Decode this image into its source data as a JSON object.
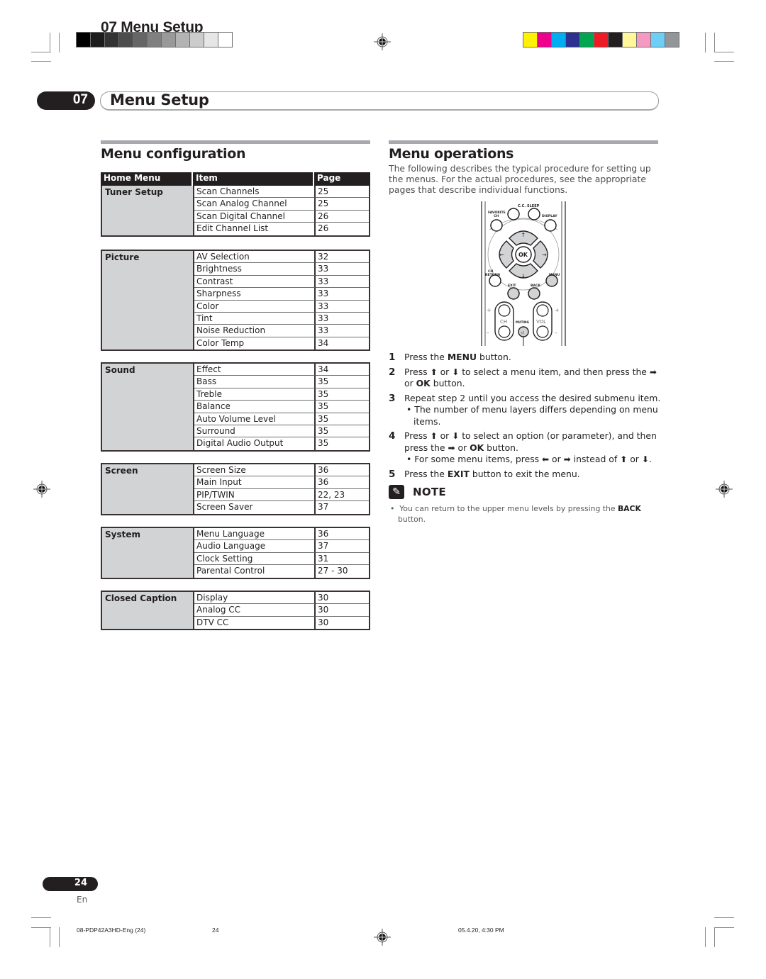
{
  "running_head": "07 Menu Setup",
  "gray_swatches": [
    "#000000",
    "#1c1c1c",
    "#333333",
    "#4d4d4d",
    "#666666",
    "#808080",
    "#999999",
    "#b3b3b3",
    "#cccccc",
    "#e6e6e6",
    "#ffffff"
  ],
  "color_swatches": [
    "#fff200",
    "#ec008c",
    "#00aeef",
    "#2e3192",
    "#00a651",
    "#ed1c24",
    "#231f20",
    "#fff799",
    "#f49ac1",
    "#6dcff6",
    "#939598"
  ],
  "chapter": {
    "number": "07",
    "title": "Menu Setup"
  },
  "menu_configuration": {
    "title": "Menu configuration",
    "headers": [
      "Home Menu",
      "Item",
      "Page"
    ],
    "groups": [
      {
        "category": "Tuner Setup",
        "rows": [
          {
            "item": "Scan Channels",
            "page": "25"
          },
          {
            "item": "Scan Analog Channel",
            "page": "25"
          },
          {
            "item": "Scan Digital Channel",
            "page": "26"
          },
          {
            "item": "Edit Channel List",
            "page": "26"
          }
        ]
      },
      {
        "category": "Picture",
        "rows": [
          {
            "item": "AV Selection",
            "page": "32"
          },
          {
            "item": "Brightness",
            "page": "33"
          },
          {
            "item": "Contrast",
            "page": "33"
          },
          {
            "item": "Sharpness",
            "page": "33"
          },
          {
            "item": "Color",
            "page": "33"
          },
          {
            "item": "Tint",
            "page": "33"
          },
          {
            "item": "Noise Reduction",
            "page": "33"
          },
          {
            "item": "Color Temp",
            "page": "34"
          }
        ]
      },
      {
        "category": "Sound",
        "rows": [
          {
            "item": "Effect",
            "page": "34"
          },
          {
            "item": "Bass",
            "page": "35"
          },
          {
            "item": "Treble",
            "page": "35"
          },
          {
            "item": "Balance",
            "page": "35"
          },
          {
            "item": "Auto Volume Level",
            "page": "35"
          },
          {
            "item": "Surround",
            "page": "35"
          },
          {
            "item": "Digital Audio Output",
            "page": "35"
          }
        ]
      },
      {
        "category": "Screen",
        "rows": [
          {
            "item": "Screen Size",
            "page": "36"
          },
          {
            "item": "Main Input",
            "page": "36"
          },
          {
            "item": "PIP/TWIN",
            "page": "22, 23"
          },
          {
            "item": "Screen Saver",
            "page": "37"
          }
        ]
      },
      {
        "category": "System",
        "rows": [
          {
            "item": "Menu Language",
            "page": "36"
          },
          {
            "item": "Audio Language",
            "page": "37"
          },
          {
            "item": "Clock Setting",
            "page": "31"
          },
          {
            "item": "Parental Control",
            "page": "27 - 30"
          }
        ]
      },
      {
        "category": "Closed Caption",
        "rows": [
          {
            "item": "Display",
            "page": "30"
          },
          {
            "item": "Analog CC",
            "page": "30"
          },
          {
            "item": "DTV CC",
            "page": "30"
          }
        ]
      }
    ]
  },
  "menu_operations": {
    "title": "Menu operations",
    "intro": "The following describes the typical procedure for setting up the menus. For the actual procedures, see the appropriate pages that describe individual functions.",
    "remote_labels": {
      "cc": "C.C.",
      "sleep": "SLEEP",
      "favorite": "FAVORITE",
      "favorite2": "CH",
      "display": "DISPLAY",
      "ok": "OK",
      "ch_return": "CH",
      "ch_return2": "RETURN",
      "menu": "MENU",
      "exit": "EXIT",
      "back": "BACK",
      "ch": "CH",
      "vol": "VOL",
      "muting": "MUTING",
      "plus": "+",
      "minus": "–"
    },
    "steps": [
      {
        "num": "1",
        "parts": [
          "Press the ",
          "MENU",
          " button."
        ]
      },
      {
        "num": "2",
        "parts": [
          "Press ",
          "⬆",
          " or ",
          "⬇",
          " to select a menu item, and then press the ",
          "➡",
          " or ",
          "OK",
          " button."
        ]
      },
      {
        "num": "3",
        "text": "Repeat step 2 until you access the desired submenu item.",
        "sub": "The number of menu layers differs depending on menu items."
      },
      {
        "num": "4",
        "parts": [
          "Press ",
          "⬆",
          " or ",
          "⬇",
          " to select an option (or parameter), and then press the ",
          "➡",
          " or ",
          "OK",
          " button."
        ],
        "sub_parts": [
          "For some menu items, press ",
          "⬅",
          " or ",
          "➡",
          " instead of ",
          "⬆",
          " or ",
          "⬇",
          "."
        ]
      },
      {
        "num": "5",
        "parts": [
          "Press the ",
          "EXIT",
          " button to exit the menu."
        ]
      }
    ],
    "note": {
      "title": "NOTE",
      "text_before": "You can return to the upper menu levels by pressing the ",
      "text_bold": "BACK",
      "text_after": " button."
    }
  },
  "footer": {
    "page_number": "24",
    "language": "En",
    "file_name": "08-PDP42A3HD-Eng (24)",
    "file_page": "24",
    "timestamp": "05.4.20, 4:30 PM"
  }
}
